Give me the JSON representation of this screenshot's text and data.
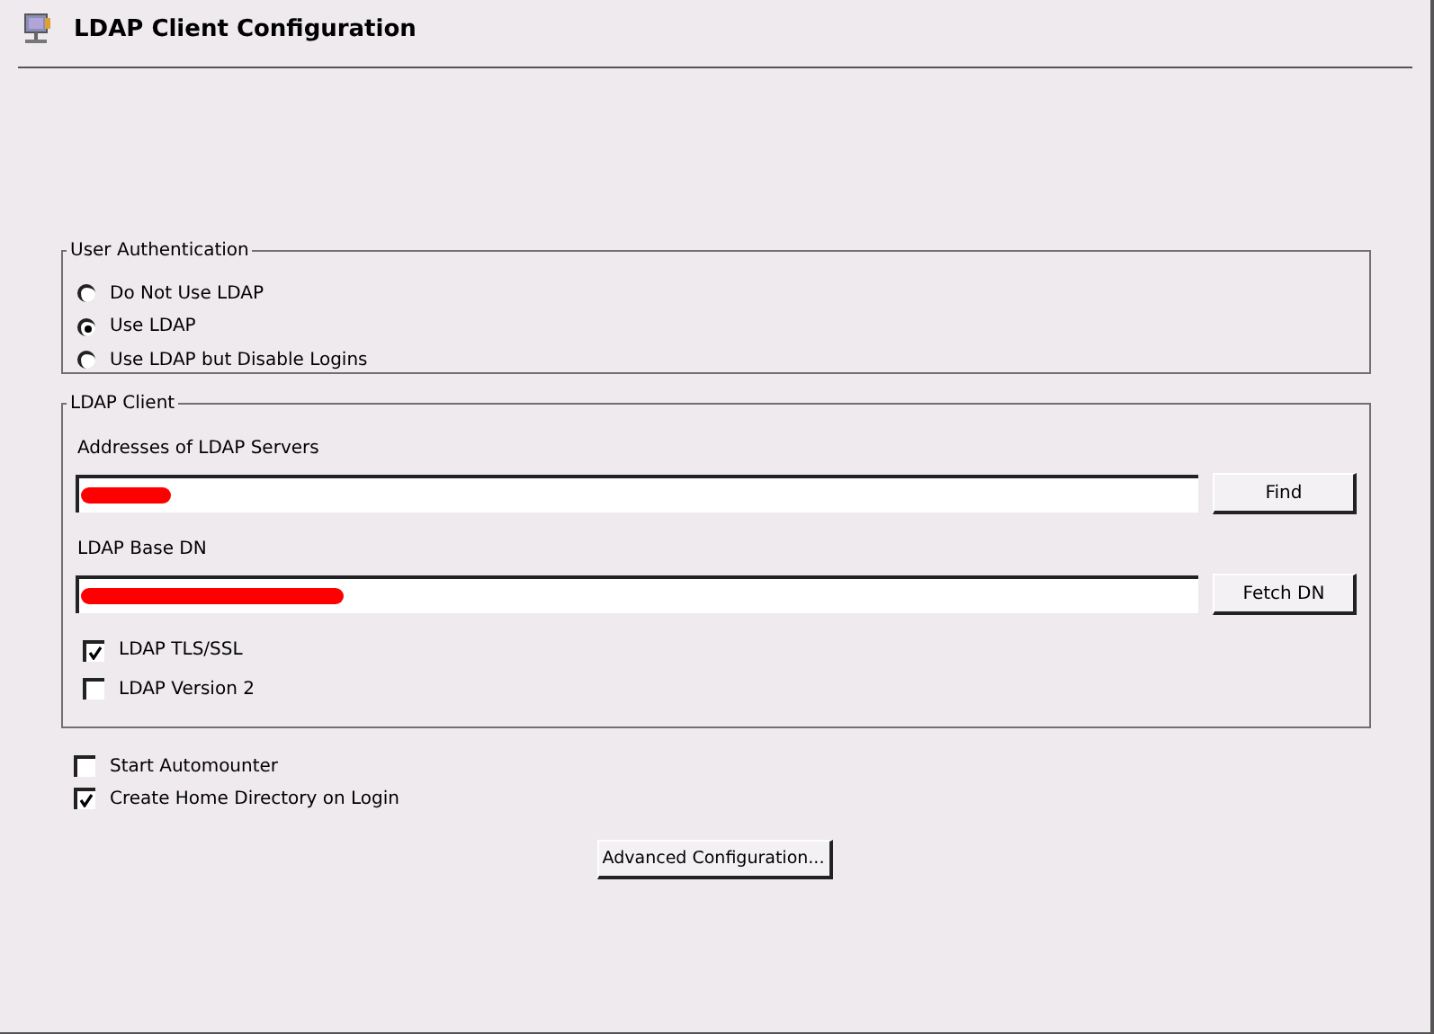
{
  "window": {
    "title": "LDAP Client Configuration"
  },
  "user_authentication": {
    "title": "User Authentication",
    "options": [
      {
        "label": "Do Not Use LDAP",
        "selected": false
      },
      {
        "label": "Use LDAP",
        "selected": true
      },
      {
        "label": "Use LDAP but Disable Logins",
        "selected": false
      }
    ]
  },
  "ldap_client": {
    "title": "LDAP Client",
    "fields": [
      {
        "label": "Addresses of LDAP Servers",
        "redacted": true,
        "button": "Find"
      },
      {
        "label": "LDAP Base DN",
        "redacted": true,
        "button": "Fetch DN"
      }
    ],
    "options": [
      {
        "label": "LDAP TLS/SSL",
        "checked": true
      },
      {
        "label": "LDAP Version 2",
        "checked": false
      }
    ]
  },
  "options": [
    {
      "label": "Start Automounter",
      "checked": false
    },
    {
      "label": "Create Home Directory on Login",
      "checked": true
    }
  ],
  "advanced_button": "Advanced Configuration..."
}
